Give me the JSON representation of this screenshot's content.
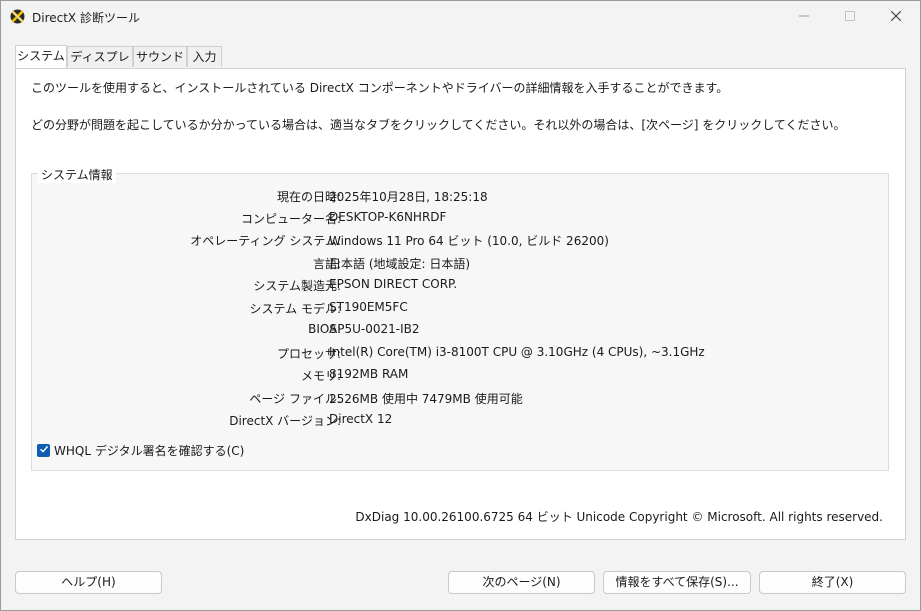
{
  "window": {
    "title": "DirectX 診断ツール"
  },
  "tabs": [
    {
      "label": "システム",
      "active": true
    },
    {
      "label": "ディスプレイ",
      "active": false
    },
    {
      "label": "サウンド",
      "active": false
    },
    {
      "label": "入力",
      "active": false
    }
  ],
  "intro": {
    "line1": "このツールを使用すると、インストールされている DirectX コンポーネントやドライバーの詳細情報を入手することができます。",
    "line2": "どの分野が問題を起こしているか分かっている場合は、適当なタブをクリックしてください。それ以外の場合は、[次ページ] をクリックしてください。"
  },
  "system_info": {
    "group_title": "システム情報",
    "rows": [
      {
        "label": "現在の日時:",
        "value": "2025年10月28日, 18:25:18"
      },
      {
        "label": "コンピューター名:",
        "value": "DESKTOP-K6NHRDF"
      },
      {
        "label": "オペレーティング システム:",
        "value": "Windows 11 Pro 64 ビット (10.0, ビルド 26200)"
      },
      {
        "label": "言語:",
        "value": "日本語 (地域設定: 日本語)"
      },
      {
        "label": "システム製造元:",
        "value": "EPSON DIRECT CORP."
      },
      {
        "label": "システム モデル:",
        "value": "ST190EM5FC"
      },
      {
        "label": "BIOS:",
        "value": "AP5U-0021-IB2"
      },
      {
        "label": "プロセッサ:",
        "value": "Intel(R) Core(TM) i3-8100T CPU @ 3.10GHz (4 CPUs), ~3.1GHz"
      },
      {
        "label": "メモリ:",
        "value": "8192MB RAM"
      },
      {
        "label": "ページ ファイル:",
        "value": "2526MB 使用中 7479MB 使用可能"
      },
      {
        "label": "DirectX バージョン:",
        "value": "DirectX 12"
      }
    ],
    "whql_checkbox": {
      "label": "WHQL デジタル署名を確認する(C)",
      "checked": true
    }
  },
  "footer": {
    "version_text": "DxDiag 10.00.26100.6725 64 ビット Unicode  Copyright © Microsoft. All rights reserved."
  },
  "buttons": {
    "help": "ヘルプ(H)",
    "next_page": "次のページ(N)",
    "save_all": "情報をすべて保存(S)...",
    "exit": "終了(X)"
  },
  "colors": {
    "accent": "#0f5cb3",
    "window_bg": "#f3f3f3",
    "panel_bg": "#ffffff"
  },
  "icons": {
    "app": "directx-icon",
    "minimize": "minimize-icon",
    "maximize": "maximize-icon",
    "close": "close-icon",
    "check": "checkmark-icon"
  }
}
